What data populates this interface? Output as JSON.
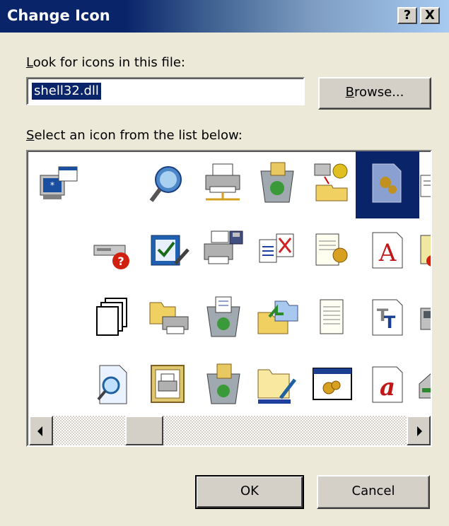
{
  "window": {
    "title": "Change Icon",
    "help_glyph": "?",
    "close_glyph": "X"
  },
  "file": {
    "label_mnemonic": "L",
    "label_rest": "ook for icons in this file:",
    "value": "shell32.dll",
    "browse_mnemonic": "B",
    "browse_rest": "rowse..."
  },
  "list": {
    "label_mnemonic": "S",
    "label_rest": "elect an icon from the list below:",
    "icons": [
      [
        "monitor-window-icon",
        "empty",
        "search-globe-icon",
        "printer-network-icon",
        "recycle-bin-full-icon",
        "network-gears-icon",
        "folder-gear-icon-selected",
        "partial-icon"
      ],
      [
        "empty",
        "drive-help-icon",
        "checkbox-pencil-icon",
        "printer-disk-icon",
        "documents-move-icon",
        "notepad-gear-icon",
        "font-a-icon",
        "partial-icon"
      ],
      [
        "empty",
        "pages-stack-icon",
        "folder-printer-icon",
        "recycle-bin-docs-icon",
        "folders-arrow-icon",
        "text-document-icon",
        "font-tt-icon",
        "partial-icon"
      ],
      [
        "empty",
        "document-search-icon",
        "framed-printer-icon",
        "recycle-bin-papers-icon",
        "folder-pen-icon",
        "window-gears-icon",
        "font-a-script-icon",
        "partial-icon"
      ]
    ],
    "selected_index": 6
  },
  "buttons": {
    "ok": "OK",
    "cancel": "Cancel"
  }
}
